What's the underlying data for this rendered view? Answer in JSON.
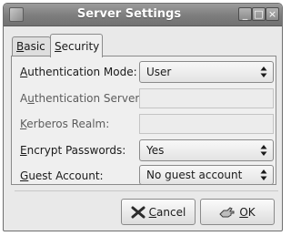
{
  "window": {
    "title": "Server Settings",
    "controls": {
      "minimize": "_",
      "maximize": "□",
      "close": "×"
    }
  },
  "tabs": [
    {
      "label": "Basic",
      "mnemonic": "B",
      "rest": "asic",
      "active": false
    },
    {
      "label": "Security",
      "mnemonic": "S",
      "rest": "ecurity",
      "active": true
    }
  ],
  "form": {
    "auth_mode": {
      "pre": "",
      "mnemonic": "A",
      "rest": "uthentication Mode:",
      "value": "User"
    },
    "auth_server": {
      "pre": "A",
      "mnemonic": "u",
      "rest": "thentication Server:",
      "value": ""
    },
    "kerberos_realm": {
      "pre": "",
      "mnemonic": "K",
      "rest": "erberos Realm:",
      "value": ""
    },
    "encrypt_passwords": {
      "pre": "",
      "mnemonic": "E",
      "rest": "ncrypt Passwords:",
      "value": "Yes"
    },
    "guest_account": {
      "pre": "",
      "mnemonic": "G",
      "rest": "uest Account:",
      "value": "No guest account"
    }
  },
  "buttons": {
    "cancel": {
      "mnemonic": "C",
      "rest": "ancel",
      "icon": "cancel-x-icon"
    },
    "ok": {
      "mnemonic": "O",
      "rest": "K",
      "icon": "ok-hand-icon"
    }
  }
}
